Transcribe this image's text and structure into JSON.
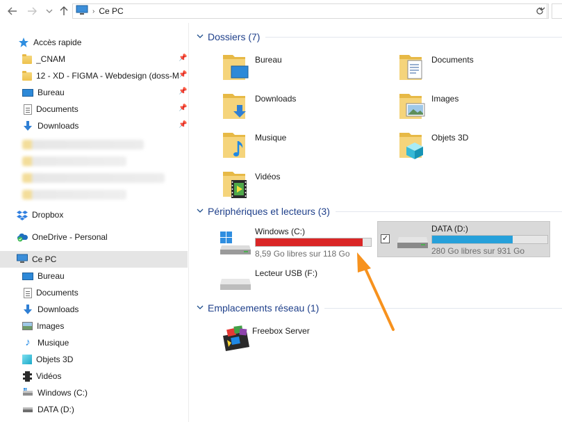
{
  "address": {
    "crumb": "Ce PC",
    "dropdown_icon": "chevron-down-icon",
    "refresh_icon": "refresh-icon"
  },
  "sidebar": {
    "quick_access": "Accès rapide",
    "pinned": [
      {
        "label": "_CNAM",
        "icon": "folder-icon"
      },
      {
        "label": "12 - XD - FIGMA - Webdesign (doss-M",
        "icon": "folder-icon"
      },
      {
        "label": "Bureau",
        "icon": "desktop-icon"
      },
      {
        "label": "Documents",
        "icon": "documents-icon"
      },
      {
        "label": "Downloads",
        "icon": "download-icon"
      }
    ],
    "dropbox": "Dropbox",
    "onedrive": "OneDrive - Personal",
    "this_pc": "Ce PC",
    "pc_items": [
      {
        "label": "Bureau",
        "icon": "desktop-icon"
      },
      {
        "label": "Documents",
        "icon": "documents-icon"
      },
      {
        "label": "Downloads",
        "icon": "download-icon"
      },
      {
        "label": "Images",
        "icon": "pictures-icon"
      },
      {
        "label": "Musique",
        "icon": "music-icon"
      },
      {
        "label": "Objets 3D",
        "icon": "objects-3d-icon"
      },
      {
        "label": "Vidéos",
        "icon": "videos-icon"
      },
      {
        "label": "Windows (C:)",
        "icon": "drive-icon"
      },
      {
        "label": "DATA (D:)",
        "icon": "drive-icon"
      }
    ]
  },
  "content": {
    "folders_header": "Dossiers (7)",
    "folders": [
      {
        "name": "Bureau"
      },
      {
        "name": "Documents"
      },
      {
        "name": "Downloads"
      },
      {
        "name": "Images"
      },
      {
        "name": "Musique"
      },
      {
        "name": "Objets 3D"
      },
      {
        "name": "Vidéos"
      }
    ],
    "devices_header": "Périphériques et lecteurs (3)",
    "drives": [
      {
        "name": "Windows (C:)",
        "free": "8,59 Go libres sur 118 Go",
        "used_fraction": 0.93,
        "bar_color": "#da2626"
      },
      {
        "name": "DATA (D:)",
        "free": "280 Go libres sur 931 Go",
        "used_fraction": 0.7,
        "bar_color": "#26a0da"
      },
      {
        "name": "Lecteur USB (F:)"
      }
    ],
    "network_header": "Emplacements réseau (1)",
    "network": [
      {
        "name": "Freebox Server"
      }
    ]
  },
  "colors": {
    "accent_header": "#1e3f8a",
    "annotation_arrow": "#f7921e",
    "selection": "#e5e5e5"
  }
}
